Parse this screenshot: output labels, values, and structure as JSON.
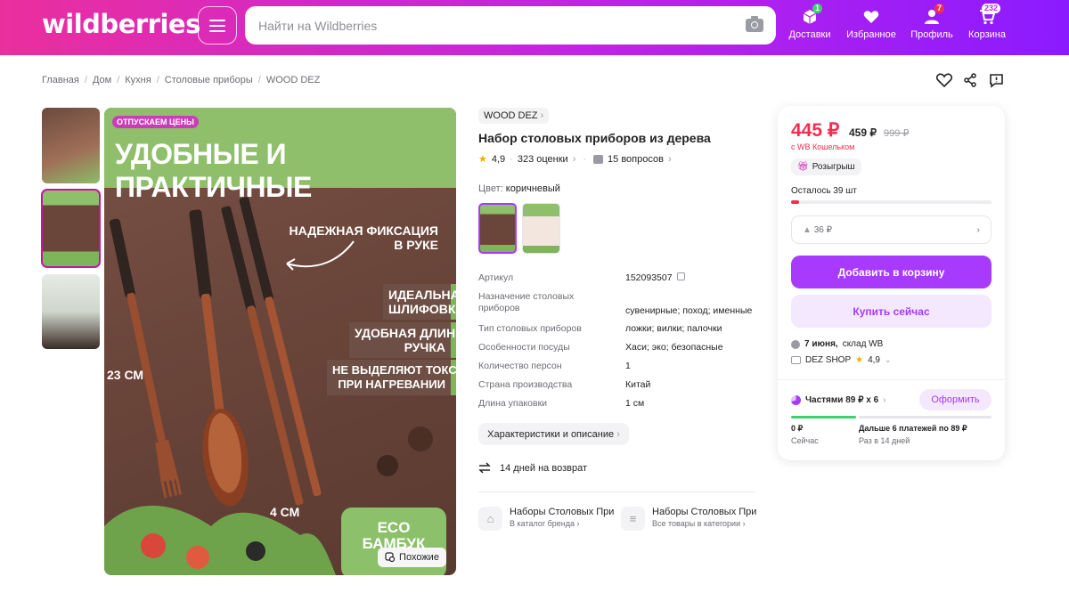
{
  "header": {
    "logo": "wildberries",
    "search_placeholder": "Найти на Wildberries",
    "nav": [
      {
        "label": "Доставки",
        "badge": "1",
        "icon": "box-icon"
      },
      {
        "label": "Избранное",
        "badge": "",
        "icon": "heart-icon"
      },
      {
        "label": "Профиль",
        "badge": "7",
        "icon": "user-icon"
      },
      {
        "label": "Корзина",
        "badge": "232",
        "icon": "cart-icon"
      }
    ]
  },
  "breadcrumbs": [
    "Главная",
    "Дом",
    "Кухня",
    "Столовые приборы",
    "WOOD DEZ"
  ],
  "gallery": {
    "promo_tag": "ОТПУСКАЕМ ЦЕНЫ",
    "headline": "УДОБНЫЕ И ПРАКТИЧНЫЕ",
    "callout_fixation": "НАДЕЖНАЯ ФИКСАЦИЯ\nВ РУКЕ",
    "features": [
      "ИДЕАЛЬНАЯ\nШЛИФОВКА",
      "УДОБНАЯ ДЛИННАЯ\nРУЧКА",
      "НЕ ВЫДЕЛЯЮТ ТОКСИНЫ\nПРИ НАГРЕВАНИИ"
    ],
    "dim_length": "23 СМ",
    "dim_width": "4 СМ",
    "eco_badge": "ECO\nБАМБУК",
    "similar_label": "Похожие"
  },
  "product": {
    "brand": "WOOD DEZ",
    "title": "Набор столовых приборов из дерева",
    "rating": "4,9",
    "reviews": "323 оценки",
    "questions": "15 вопросов",
    "color_label": "Цвет:",
    "color_value": "коричневый",
    "specs": [
      {
        "k": "Артикул",
        "v": "152093507"
      },
      {
        "k": "Назначение столовых приборов",
        "v": "сувенирные; поход; именные"
      },
      {
        "k": "Тип столовых приборов",
        "v": "ложки; вилки; палочки"
      },
      {
        "k": "Особенности посуды",
        "v": "Хаси; эко; безопасные"
      },
      {
        "k": "Количество персон",
        "v": "1"
      },
      {
        "k": "Страна производства",
        "v": "Китай"
      },
      {
        "k": "Длина упаковки",
        "v": "1 см"
      }
    ],
    "specs_button": "Характеристики и описание",
    "return_policy": "14 дней на возврат",
    "categories": [
      {
        "title": "Наборы Столовых Приборов",
        "sub": "В каталог бренда"
      },
      {
        "title": "Наборы Столовых Приборов",
        "sub": "Все товары в категории"
      }
    ]
  },
  "buybox": {
    "price": "445 ₽",
    "price_regular": "459 ₽",
    "price_old": "999 ₽",
    "wallet_note": "с WB Кошельком",
    "raffle": "Розыгрыш",
    "stock_left": "Осталось 39 шт",
    "stock_fraction": 0.04,
    "discount_hint": "36 ₽",
    "add_to_cart": "Добавить в корзину",
    "buy_now": "Купить сейчас",
    "delivery_date": "7 июня,",
    "delivery_place": "склад WB",
    "seller": "DEZ SHOP",
    "seller_rating": "4,9",
    "installments": "Частями 89 ₽ х 6",
    "installments_button": "Оформить",
    "pay_now_amount": "0 ₽",
    "pay_now_label": "Сейчас",
    "pay_later_amount": "Дальше 6 платежей по 89 ₽",
    "pay_later_label": "Раз в 14 дней"
  },
  "colors": {
    "accent": "#a73afd",
    "price_red": "#f42d4f",
    "header_start": "#ea2f9d",
    "header_end": "#8a1bff"
  }
}
